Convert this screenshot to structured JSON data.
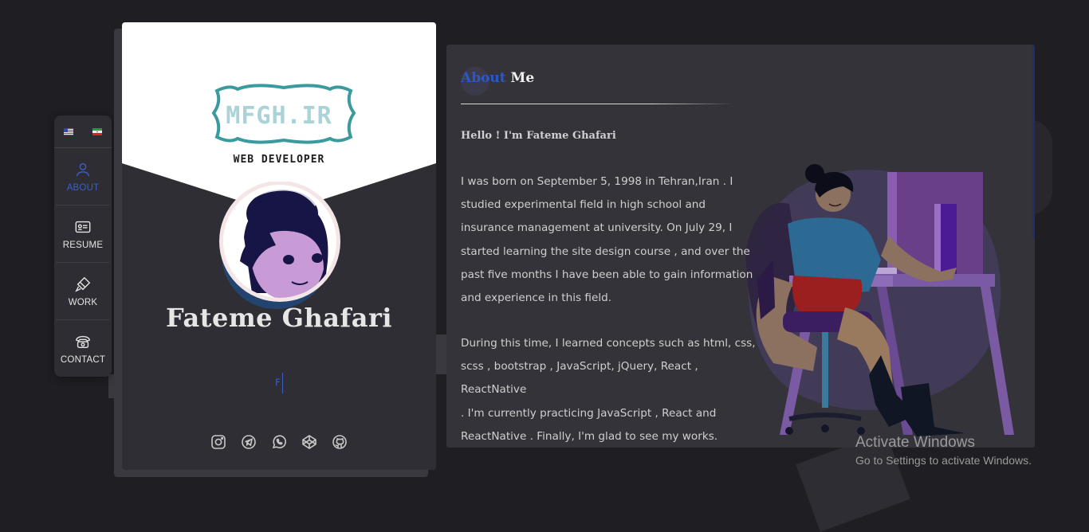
{
  "languages": [
    {
      "name": "english-flag"
    },
    {
      "name": "iran-flag"
    }
  ],
  "nav": [
    {
      "label": "ABOUT",
      "icon": "user-icon",
      "active": true
    },
    {
      "label": "RESUME",
      "icon": "id-card-icon",
      "active": false
    },
    {
      "label": "WORK",
      "icon": "brush-icon",
      "active": false
    },
    {
      "label": "CONTACT",
      "icon": "phone-icon",
      "active": false
    }
  ],
  "profile": {
    "logo_text": "MFGH.IR",
    "logo_subtitle": "WEB DEVELOPER",
    "name": "Fateme Ghafari",
    "typed_text": "F",
    "socials": [
      "instagram-icon",
      "telegram-icon",
      "whatsapp-icon",
      "codepen-icon",
      "github-icon"
    ]
  },
  "about": {
    "title_highlight": "About",
    "title_rest": " Me",
    "greeting": "Hello ! I'm Fateme Ghafari",
    "paragraph1_lines": [
      "I was born on September 5, 1998 in Tehran,Iran . I",
      "studied experimental field in high school and",
      "insurance management at university. On July 29, I",
      "started learning the site design course , and over the",
      "past five months I have been able to gain information",
      "and experience in this field."
    ],
    "paragraph2_lines": [
      "During this time, I learned concepts such as html, css,",
      "scss , bootstrap , JavaScript, jQuery, React , ReactNative",
      ". I'm currently practicing JavaScript , React and",
      "ReactNative . Finally, I'm glad to see my works."
    ]
  },
  "watermark": {
    "title": "Activate Windows",
    "subtitle": "Go to Settings to activate Windows."
  },
  "colors": {
    "accent": "#2c57c9",
    "background": "#1f1e23",
    "panel": "#34333a",
    "card": "#2f2e34"
  }
}
